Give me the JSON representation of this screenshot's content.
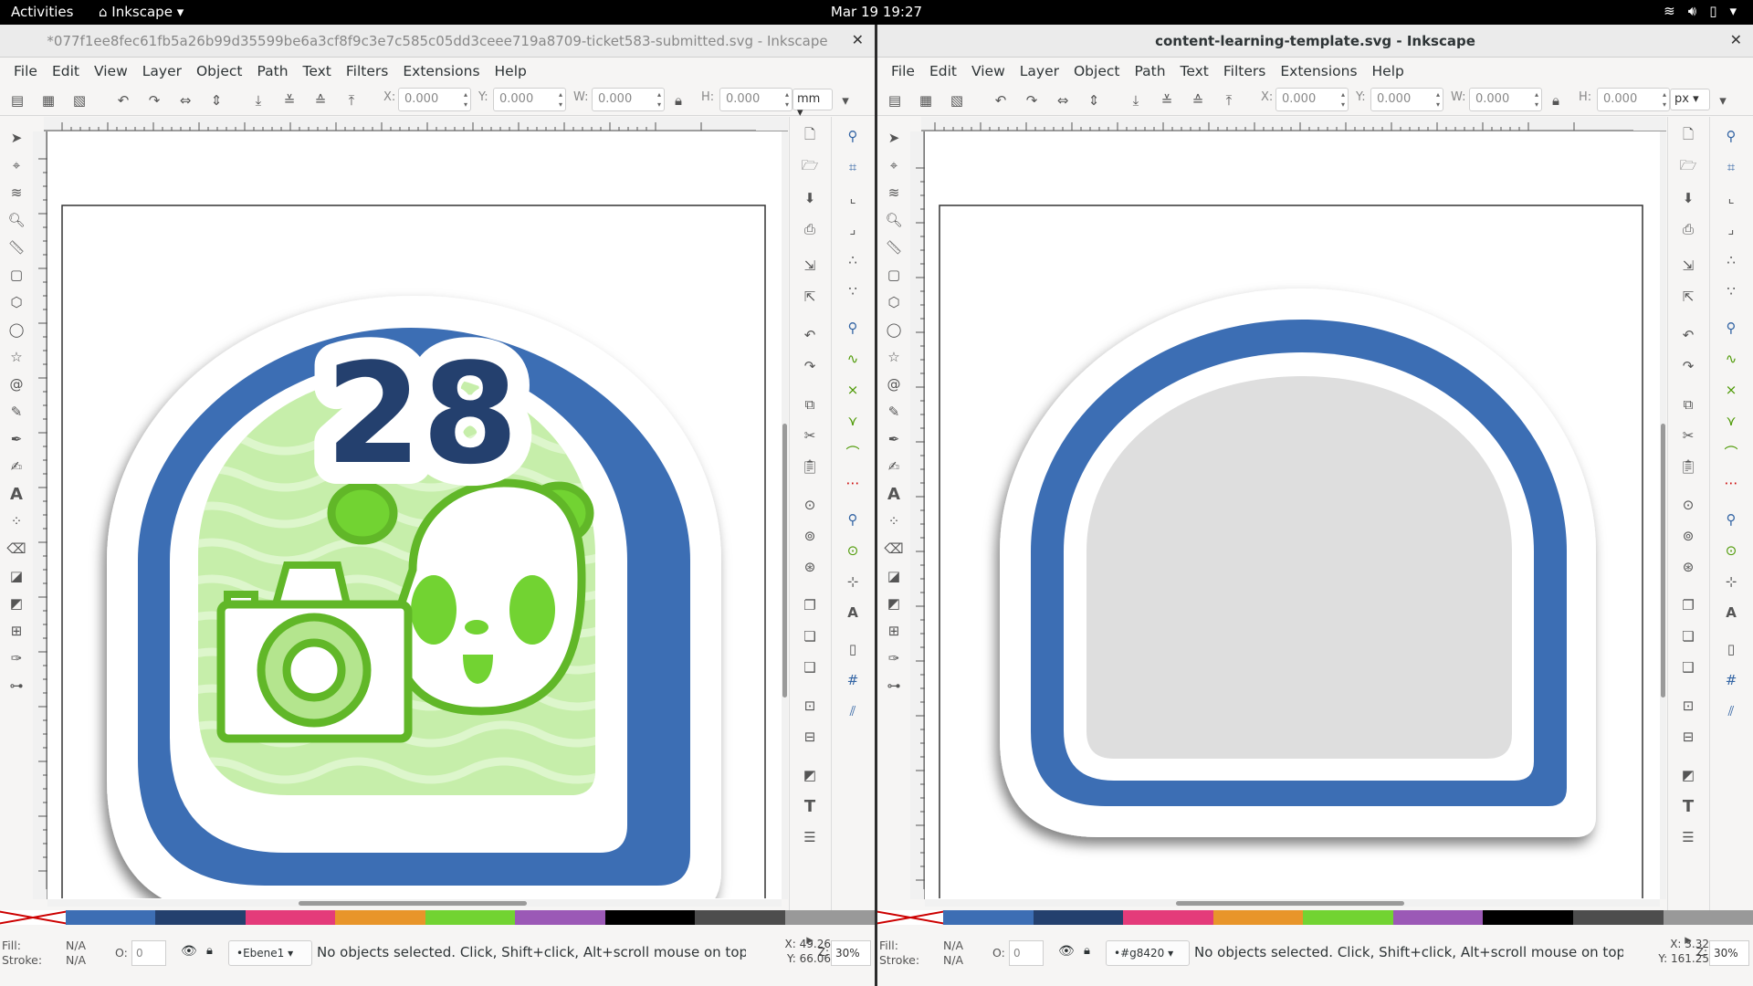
{
  "topbar": {
    "activities": "Activities",
    "app": "Inkscape",
    "clock": "Mar 19  19:27"
  },
  "menu": [
    "File",
    "Edit",
    "View",
    "Layer",
    "Object",
    "Path",
    "Text",
    "Filters",
    "Extensions",
    "Help"
  ],
  "window1": {
    "title": "*077f1ee8fec61fb5a26b99d35599be6a3cf8f9c3e7c585c05dd3ceee719a8709-ticket583-submitted.svg - Inkscape",
    "fields": {
      "x_label": "X:",
      "x": "0.000",
      "y_label": "Y:",
      "y": "0.000",
      "w_label": "W:",
      "w": "0.000",
      "h_label": "H:",
      "h": "0.000",
      "unit": "mm"
    },
    "badge_number": "28",
    "status": {
      "fill_label": "Fill:",
      "fill": "N/A",
      "stroke_label": "Stroke:",
      "stroke": "N/A",
      "opacity_label": "O:",
      "opacity": "0",
      "layer": "•Ebene1",
      "message": "No objects selected. Click, Shift+click, Alt+scroll mouse on top of objec...",
      "x_label": "X:",
      "x": "49.26",
      "y_label": "Y:",
      "y": "66.06",
      "zoom_label": "Z:",
      "zoom": "30%"
    }
  },
  "window2": {
    "title": "content-learning-template.svg - Inkscape",
    "fields": {
      "x_label": "X:",
      "x": "0.000",
      "y_label": "Y:",
      "y": "0.000",
      "w_label": "W:",
      "w": "0.000",
      "h_label": "H:",
      "h": "0.000",
      "unit": "px"
    },
    "status": {
      "fill_label": "Fill:",
      "fill": "N/A",
      "stroke_label": "Stroke:",
      "stroke": "N/A",
      "opacity_label": "O:",
      "opacity": "0",
      "layer": "•#g8420",
      "message": "No objects selected. Click, Shift+click, Alt+scroll mouse on top of object...",
      "x_label": "X:",
      "x": "3.32",
      "y_label": "Y:",
      "y": "161.25",
      "zoom_label": "Z:",
      "zoom": "30%"
    }
  },
  "palette_colors": [
    "#3d6eb4",
    "#24406e",
    "#e43b7a",
    "#e8952a",
    "#72d332",
    "#9b59b6",
    "#000000",
    "#4d4d4d",
    "#999999"
  ],
  "colors": {
    "badge_blue": "#3c6eb4",
    "badge_navy": "#24406e",
    "panda_green": "#61b728",
    "bg_green": "#c6eeaa",
    "template_gray": "#dedede"
  },
  "icons": {
    "select": "selector-tool-icon",
    "node": "node-tool-icon",
    "text": "text-tool-icon",
    "zoom": "zoom-tool-icon"
  }
}
